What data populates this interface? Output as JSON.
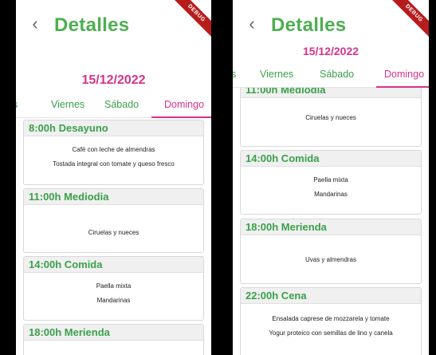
{
  "screen1": {
    "back_icon": "chevron-left-icon",
    "title": "Detalles",
    "debug_banner": "DEBUG",
    "date": "15/12/2022",
    "tabs": [
      "s",
      "Viernes",
      "Sábado",
      "Domingo"
    ],
    "active_tab": "Domingo",
    "meals": [
      {
        "header": "8:00h Desayuno",
        "items": [
          "Café con leche de almendras",
          "Tostada integral con tomate y queso fresco"
        ]
      },
      {
        "header": "11:00h Mediodia",
        "items": [
          "Ciruelas y nueces"
        ]
      },
      {
        "header": "14:00h Comida",
        "items": [
          "Paella mixta",
          "Mandarinas"
        ]
      },
      {
        "header": "18:00h Merienda",
        "items": []
      }
    ]
  },
  "screen2": {
    "back_icon": "chevron-left-icon",
    "title": "Detalles",
    "debug_banner": "DEBUG",
    "date": "15/12/2022",
    "tabs": [
      "s",
      "Viernes",
      "Sábado",
      "Domingo"
    ],
    "active_tab": "Domingo",
    "meals": [
      {
        "header": "11:00h Mediodia",
        "items": [
          "Ciruelas y nueces"
        ]
      },
      {
        "header": "14:00h Comida",
        "items": [
          "Paella mixta",
          "Mandarinas"
        ]
      },
      {
        "header": "18:00h Merienda",
        "items": [
          "Uvas y almendras"
        ]
      },
      {
        "header": "22:00h Cena",
        "items": [
          "Ensalada caprese de mozzarela y tomate",
          "Yogur proteico con semillas de lino y canela"
        ]
      }
    ]
  },
  "colors": {
    "title_green": "#4caf50",
    "accent_pink": "#d6338a",
    "card_header_bg": "#f0f0f0"
  }
}
